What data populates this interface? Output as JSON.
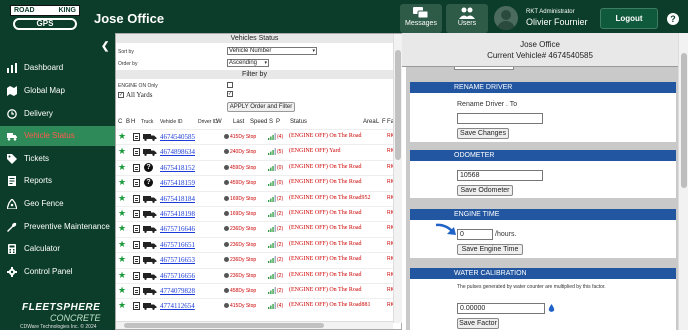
{
  "header": {
    "logo_top_left": "ROAD",
    "logo_top_right": "KING",
    "logo_bottom": "GPS",
    "company": "Jose Office",
    "messages_label": "Messages",
    "users_label": "Users",
    "user_role": "RKT Administrator",
    "user_name": "Olivier Fournier",
    "logout_label": "Logout",
    "help_label": "?"
  },
  "sidebar": {
    "collapse_glyph": "❮",
    "items": [
      {
        "label": "Dashboard",
        "icon": "bar-chart-icon"
      },
      {
        "label": "Global Map",
        "icon": "map-icon"
      },
      {
        "label": "Delivery",
        "icon": "clock-icon"
      },
      {
        "label": "Vehicle Status",
        "icon": "truck-icon",
        "active": true
      },
      {
        "label": "Tickets",
        "icon": "tag-icon"
      },
      {
        "label": "Reports",
        "icon": "report-icon"
      },
      {
        "label": "Geo Fence",
        "icon": "geofence-icon"
      },
      {
        "label": "Preventive Maintenance",
        "icon": "wrench-icon"
      },
      {
        "label": "Calculator",
        "icon": "calculator-icon"
      },
      {
        "label": "Control Panel",
        "icon": "gear-icon"
      }
    ],
    "brand_line1": "FLEETSPHERE",
    "brand_line2": "CONCRETE",
    "copyright": "CDWare Technologies Inc. © 2024"
  },
  "vehicles_status": {
    "title": "Vehicles Status",
    "sort_by_label": "Sort by",
    "sort_by_value": "Vehicle Number",
    "order_by_label": "Order by",
    "order_by_value": "Ascending",
    "filter_by_label": "Filter by",
    "engine_on_only_label": "ENGINE ON Only",
    "all_yards_label": "All Yards",
    "engine_on_only_checked": false,
    "all_yards_checked": true,
    "apply_label": "APPLY Order and Filter",
    "columns": {
      "c": "C",
      "b": "B",
      "h": "H",
      "truck": "Truck",
      "vehicle_id": "Vehicle ID",
      "driver_id": "Driver ID",
      "w": "W",
      "last": "Last",
      "speed": "Speed",
      "s": "S",
      "p": "P",
      "status": "Status",
      "area": "Area",
      "l": "L",
      "f": "F",
      "fa": "Fa"
    },
    "rows": [
      {
        "id": "4674540585",
        "kind": "truck",
        "last": "415Dy Stop",
        "sat": "(4)",
        "status": "(ENGINE OFF) On The Road",
        "rk": "RK"
      },
      {
        "id": "4674898634",
        "kind": "truck",
        "last": "240Dy Stop",
        "sat": "(5)",
        "status": "(ENGINE OFF) Yard",
        "rk": "RK"
      },
      {
        "id": "4675418152",
        "kind": "question",
        "last": "459Dy Stop",
        "sat": "(0)",
        "status": "(ENGINE OFF) On The Road",
        "rk": "RK"
      },
      {
        "id": "4675418159",
        "kind": "question",
        "last": "459Dy Stop",
        "sat": "(0)",
        "status": "(ENGINE OFF) On The Road",
        "rk": "RK"
      },
      {
        "id": "4675418184",
        "kind": "truck",
        "last": "169Dy Stop",
        "sat": "(2)",
        "status": "(ENGINE OFF) On The Road952",
        "rk": "RK"
      },
      {
        "id": "4675418198",
        "kind": "truck",
        "last": "169Dy Stop",
        "sat": "(2)",
        "status": "(ENGINE OFF) On The Road",
        "rk": "RK"
      },
      {
        "id": "4675716646",
        "kind": "truck",
        "last": "236Dy Stop",
        "sat": "(2)",
        "status": "(ENGINE OFF) On The Road",
        "rk": "RK"
      },
      {
        "id": "4675716651",
        "kind": "truck",
        "last": "236Dy Stop",
        "sat": "(2)",
        "status": "(ENGINE OFF) On The Road",
        "rk": "RK"
      },
      {
        "id": "4675716653",
        "kind": "truck",
        "last": "236Dy Stop",
        "sat": "(2)",
        "status": "(ENGINE OFF) On The Road",
        "rk": "RK"
      },
      {
        "id": "4675716656",
        "kind": "truck",
        "last": "236Dy Stop",
        "sat": "(2)",
        "status": "(ENGINE OFF) On The Road",
        "rk": "RK"
      },
      {
        "id": "4774079828",
        "kind": "truck",
        "last": "458Dy Stop",
        "sat": "(2)",
        "status": "(ENGINE OFF) On The Road",
        "rk": "RK"
      },
      {
        "id": "4774112654",
        "kind": "truck",
        "last": "415Dy Stop",
        "sat": "(4)",
        "status": "(ENGINE OFF) On The Road881",
        "rk": "RK"
      }
    ]
  },
  "details": {
    "driver": "Jose Office",
    "current_vehicle": "Current Vehicle# 4674540585",
    "rename_title": "RENAME DRIVER",
    "rename_label": "Rename Driver . To",
    "rename_value": "",
    "rename_button": "Save Changes",
    "odometer_title": "ODOMETER",
    "odometer_value": "10568",
    "odometer_button": "Save Odometer",
    "engine_title": "ENGINE TIME",
    "engine_value": "0",
    "engine_unit": "/hours.",
    "engine_button": "Save Engine Time",
    "water_title": "WATER CALIBRATION",
    "water_note": "The pulses generated by water counter are multiplied by this factor.",
    "water_value": "0.00000",
    "water_button": "Save Factor"
  },
  "colors": {
    "header_bg": "#0b3d2a",
    "active_nav": "#2e8a58",
    "active_text": "#ff5a4a",
    "card_header": "#2256a0",
    "status_red": "#cc0000",
    "link_blue": "#1a3bd8"
  }
}
